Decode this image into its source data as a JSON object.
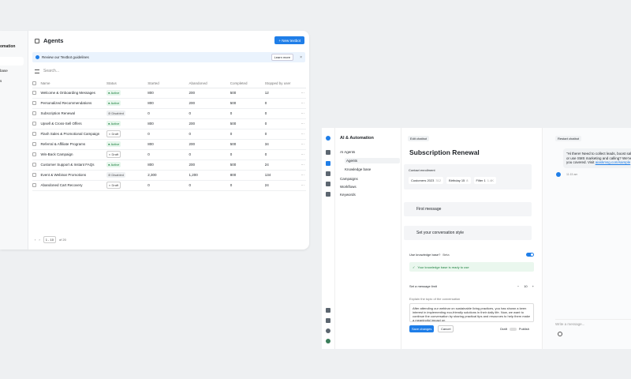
{
  "agents_window": {
    "sidebar": {
      "title_part1": "",
      "title_part2": "omation",
      "item1": "base",
      "item2": "s"
    },
    "title": "Agents",
    "new_button": "+ New textbot",
    "banner": {
      "text": "Review our Textbot guidelines",
      "learn_more": "Learn more",
      "close": "×"
    },
    "search_placeholder": "Search...",
    "columns": [
      "Name",
      "Status",
      "Started",
      "Abandoned",
      "Completed",
      "Stopped by user"
    ],
    "rows": [
      {
        "name": "Welcome & Onboarding Messages",
        "status": "Active",
        "started": "800",
        "abandoned": "200",
        "completed": "500",
        "stopped": "12"
      },
      {
        "name": "Personalized Recommendations",
        "status": "Active",
        "started": "800",
        "abandoned": "200",
        "completed": "500",
        "stopped": "0"
      },
      {
        "name": "Subscription Renewal",
        "status": "Disabled",
        "started": "0",
        "abandoned": "0",
        "completed": "0",
        "stopped": "0"
      },
      {
        "name": "Upsell & Cross-Sell Offers",
        "status": "Active",
        "started": "800",
        "abandoned": "200",
        "completed": "500",
        "stopped": "0"
      },
      {
        "name": "Flash Sales & Promotional Campaign",
        "status": "Draft",
        "started": "0",
        "abandoned": "0",
        "completed": "0",
        "stopped": "0"
      },
      {
        "name": "Referral & Affiliate Programs",
        "status": "Active",
        "started": "800",
        "abandoned": "200",
        "completed": "500",
        "stopped": "34"
      },
      {
        "name": "Win-Back Campaign",
        "status": "Draft",
        "started": "0",
        "abandoned": "0",
        "completed": "0",
        "stopped": "0"
      },
      {
        "name": "Customer Support & Instant FAQs",
        "status": "Active",
        "started": "800",
        "abandoned": "200",
        "completed": "500",
        "stopped": "24"
      },
      {
        "name": "Event & Webinar Promotions",
        "status": "Disabled",
        "started": "2,300",
        "abandoned": "1,200",
        "completed": "800",
        "stopped": "134"
      },
      {
        "name": "Abandoned Cart Recovery",
        "status": "Draft",
        "started": "0",
        "abandoned": "0",
        "completed": "0",
        "stopped": "24"
      }
    ],
    "pagination": {
      "prev": "‹",
      "next": "›",
      "range": "1 - 10",
      "total": "of 20"
    }
  },
  "editor_window": {
    "nav": {
      "title": "AI & Automation",
      "ai_agents": "AI Agents",
      "agents": "Agents",
      "knowledge_base": "Knowledge base",
      "campaigns": "Campaigns",
      "workflows": "Workflows",
      "keywords": "Keywords"
    },
    "back_label": "Edit chatbot",
    "page_title": "Subscription Renewal",
    "enrollment": {
      "label": "Contact enrollment",
      "chips": [
        {
          "label": "Customers 2023",
          "count": "312"
        },
        {
          "label": "Birthday 15",
          "count": "8"
        },
        {
          "label": "Filter 1",
          "count": "1.4K"
        }
      ]
    },
    "first_message": "First message",
    "conv_style": "Set your conversation style",
    "use_kb": {
      "label": "Use knowledge base?",
      "value": "Beta"
    },
    "kb_ready": "Your knowledge base is ready to use",
    "msg_limit": {
      "label": "Set a message limit",
      "value": "10",
      "minus": "−",
      "plus": "+"
    },
    "topic_label": "Explain the topic of the conversation",
    "topic_text": "After attending our webinar on sustainable living practices, you has shown a keen interest in implementing eco-friendly solutions in their daily life. Now, we want to continue the conversation by sharing practical tips and resources to help them make a meaningful impact on",
    "save": "Save changes",
    "cancel": "Cancel",
    "draft": "Draft",
    "publish": "Publish"
  },
  "chat_panel": {
    "restart": "Restart chatbot",
    "bubble_text": "\"Hi there! Need to collect leads, boost sales, or use SMS marketing and calling? We've got you covered. Visit",
    "bubble_link": "aiaskmsg.com/sample",
    "time": "11:15 am",
    "placeholder": "Write a message..."
  }
}
